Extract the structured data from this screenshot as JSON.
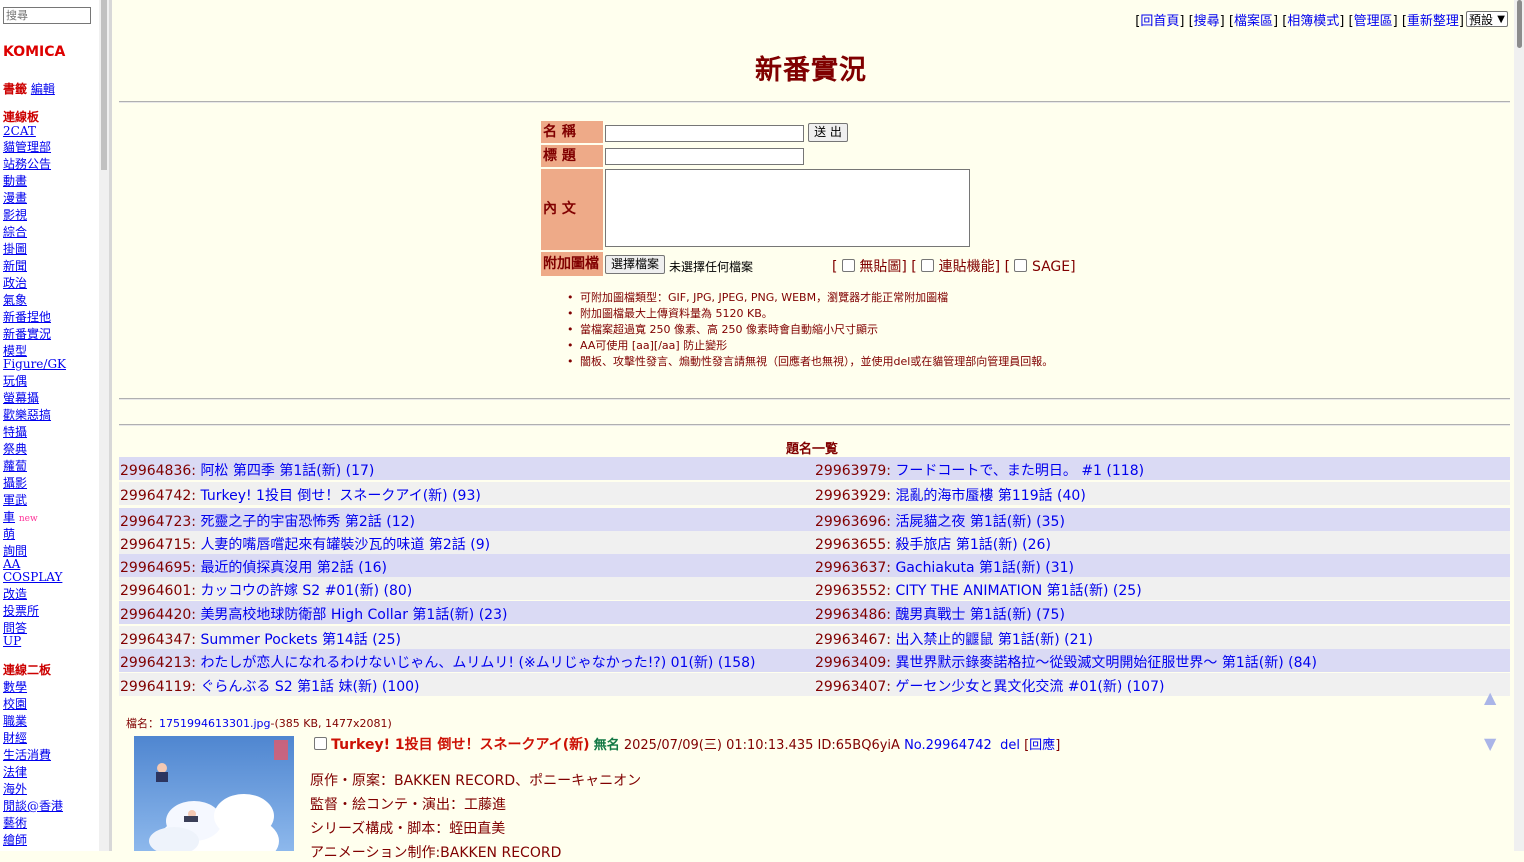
{
  "sidebar": {
    "search_placeholder": "搜尋",
    "logo": "KOMICA",
    "bookmarks_label": "書籤",
    "edit_label": "編輯",
    "section1_title": "連線板",
    "section1": [
      "2CAT",
      "貓管理部",
      "站務公告",
      "動畫",
      "漫畫",
      "影視",
      "綜合",
      "掛圖",
      "新聞",
      "政治",
      "氣象",
      "新番捏他",
      "新番實況",
      "模型",
      "Figure/GK",
      "玩偶",
      "螢幕攝",
      "歡樂惡搞",
      "特攝",
      "祭典",
      "蘿蔔",
      "攝影",
      "軍武",
      "車",
      "萌",
      "詢問",
      "AA",
      "COSPLAY",
      "改造",
      "投票所",
      "問答",
      "UP"
    ],
    "new_badge": "new",
    "section2_title": "連線二板",
    "section2": [
      "數學",
      "校園",
      "職業",
      "財經",
      "生活消費",
      "法律",
      "海外",
      "閒談@香港",
      "藝術",
      "繪師"
    ]
  },
  "topnav": {
    "items": [
      "回首頁",
      "搜尋",
      "檔案區",
      "相簿模式",
      "管理區",
      "重新整理"
    ],
    "select_value": "預設"
  },
  "page_title": "新番實況",
  "form": {
    "name_label": "名 稱",
    "subject_label": "標 題",
    "content_label": "內 文",
    "attach_label": "附加圖檔",
    "submit_label": "送 出",
    "file_button": "選擇檔案",
    "file_status": "未選擇任何檔案",
    "opt_noimg": "無貼圖",
    "opt_link": "連貼機能",
    "opt_sage": "SAGE"
  },
  "rules": [
    "可附加圖檔類型：GIF, JPG, JPEG, PNG, WEBM，瀏覽器才能正常附加圖檔",
    "附加圖檔最大上傳資料量為 5120 KB。",
    "當檔案超過寬 250 像素、高 250 像素時會自動縮小尺寸顯示",
    "AA可使用 [aa][/aa] 防止變形",
    "闇板、攻擊性發言、煽動性發言請無視（回應者也無視），並使用del或在貓管理部向管理員回報。"
  ],
  "thread_list_title": "題名一覧",
  "threads_left": [
    {
      "no": "29964836",
      "title": "阿松 第四季 第1話(新) (17)"
    },
    {
      "no": "29964742",
      "title": "Turkey! 1投目 倒せ！スネークアイ(新) (93)"
    },
    {
      "no": "29964723",
      "title": "死靈之子的宇宙恐怖秀 第2話 (12)"
    },
    {
      "no": "29964715",
      "title": "人妻的嘴唇嚐起來有罐裝沙瓦的味道 第2話 (9)"
    },
    {
      "no": "29964695",
      "title": "最近的偵探真沒用 第2話 (16)"
    },
    {
      "no": "29964601",
      "title": "カッコウの許嫁 S2 #01(新) (80)"
    },
    {
      "no": "29964420",
      "title": "美男高校地球防衛部 High Collar 第1話(新) (23)"
    },
    {
      "no": "29964347",
      "title": "Summer Pockets 第14話 (25)"
    },
    {
      "no": "29964213",
      "title": "わたしが恋人になれるわけないじゃん、ムリムリ! (※ムリじゃなかった!?) 01(新) (158)"
    },
    {
      "no": "29964119",
      "title": "ぐらんぶる S2 第1話 妹(新) (100)"
    }
  ],
  "threads_right": [
    {
      "no": "29963979",
      "title": "フードコートで、また明日。 #1 (118)"
    },
    {
      "no": "29963929",
      "title": "混亂的海市蜃樓 第119話 (40)"
    },
    {
      "no": "29963696",
      "title": "活屍貓之夜 第1話(新) (35)"
    },
    {
      "no": "29963655",
      "title": "殺手旅店 第1話(新) (26)"
    },
    {
      "no": "29963637",
      "title": "Gachiakuta 第1話(新) (31)"
    },
    {
      "no": "29963552",
      "title": "CITY THE ANIMATION 第1話(新) (25)"
    },
    {
      "no": "29963486",
      "title": "醜男真戰士 第1話(新) (75)"
    },
    {
      "no": "29963467",
      "title": "出入禁止的鼴鼠 第1話(新) (21)"
    },
    {
      "no": "29963409",
      "title": "異世界默示錄麥諾格拉～從毀滅文明開始征服世界～ 第1話(新) (84)"
    },
    {
      "no": "29963407",
      "title": "ゲーセン少女と異文化交流 #01(新) (107)"
    }
  ],
  "post": {
    "file_label": "檔名：",
    "file_name": "1751994613301.jpg",
    "file_meta": "-(385 KB, 1477x2081)",
    "subject": "Turkey! 1投目 倒せ！スネークアイ(新)",
    "name": "無名",
    "datetime": "2025/07/09(三) 01:10:13.435 ID:65BQ6yiA",
    "number": "No.29964742",
    "del": "del",
    "reply": "回應",
    "lines": [
      "原作・原案：BAKKEN RECORD、ポニーキャニオン",
      "監督・絵コンテ・演出：工藤進",
      "シリーズ構成・脚本：蛭田直美",
      "アニメーション制作:BAKKEN RECORD"
    ]
  }
}
